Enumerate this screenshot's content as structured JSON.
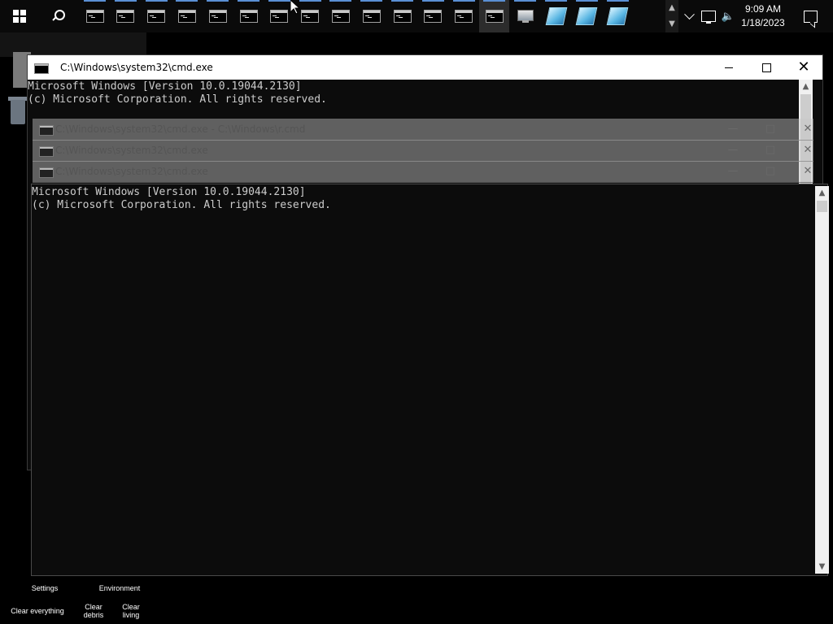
{
  "taskbar": {
    "app_buttons": [
      {
        "kind": "cmd"
      },
      {
        "kind": "cmd"
      },
      {
        "kind": "cmd"
      },
      {
        "kind": "cmd"
      },
      {
        "kind": "cmd"
      },
      {
        "kind": "cmd"
      },
      {
        "kind": "cmd"
      },
      {
        "kind": "cmd"
      },
      {
        "kind": "cmd"
      },
      {
        "kind": "cmd"
      },
      {
        "kind": "cmd"
      },
      {
        "kind": "cmd"
      },
      {
        "kind": "cmd"
      },
      {
        "kind": "cmd",
        "active": true
      },
      {
        "kind": "monitor"
      },
      {
        "kind": "pane"
      },
      {
        "kind": "pane"
      },
      {
        "kind": "pane"
      }
    ],
    "tray": {
      "time": "9:09 AM",
      "date": "1/18/2023",
      "icons": [
        "chevron-up-icon",
        "network-icon",
        "volume-icon",
        "notification-icon"
      ]
    },
    "accent_color": "#5a8fd4"
  },
  "back_window": {
    "title": "C:\\Windows\\system32\\cmd.exe",
    "ghost_title": "C:\\Windows\\system32\\cmd.exe - C:\\Windows\\r.cmd",
    "lines": [
      "Microsoft Windows [Version 10.0.19044.2130]",
      "(c) Microsoft Corporation. All rights reserved."
    ]
  },
  "ghost_bars": [
    {
      "title": "C:\\Windows\\system32\\cmd.exe - C:\\Windows\\r.cmd"
    },
    {
      "title": "C:\\Windows\\system32\\cmd.exe"
    },
    {
      "title": "C:\\Windows\\system32\\cmd.exe"
    }
  ],
  "front_window": {
    "lines": [
      "Microsoft Windows [Version 10.0.19044.2130]",
      "(c) Microsoft Corporation. All rights reserved."
    ]
  },
  "bottom_controls": {
    "settings": "Settings",
    "environment": "Environment",
    "clear_everything": "Clear everything",
    "clear_debris_1": "Clear",
    "clear_debris_2": "debris",
    "clear_living_1": "Clear",
    "clear_living_2": "living"
  }
}
